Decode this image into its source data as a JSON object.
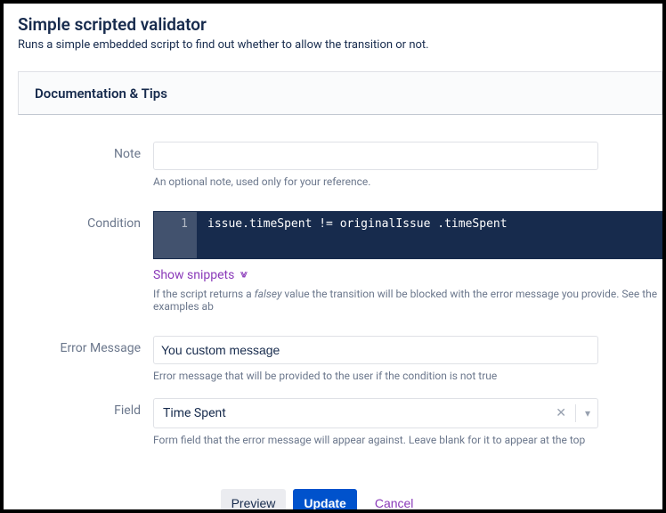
{
  "header": {
    "title": "Simple scripted validator",
    "subtitle": "Runs a simple embedded script to find out whether to allow the transition or not."
  },
  "docs": {
    "title": "Documentation & Tips"
  },
  "form": {
    "note": {
      "label": "Note",
      "value": "",
      "help": "An optional note, used only for your reference."
    },
    "condition": {
      "label": "Condition",
      "line_number": "1",
      "code": "issue.timeSpent != originalIssue .timeSpent",
      "snippets_label": "Show snippets",
      "help": "If the script returns a falsey value the transition will be blocked with the error message you provide. See the examples ab"
    },
    "error_message": {
      "label": "Error Message",
      "value": "You custom message",
      "help": "Error message that will be provided to the user if the condition is not true"
    },
    "field": {
      "label": "Field",
      "value": "Time Spent",
      "help": "Form field that the error message will appear against. Leave blank for it to appear at the top"
    }
  },
  "actions": {
    "preview": "Preview",
    "update": "Update",
    "cancel": "Cancel"
  }
}
